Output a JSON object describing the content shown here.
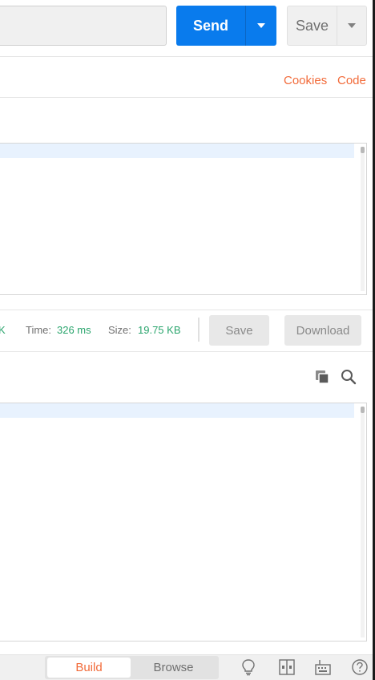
{
  "request": {
    "send_label": "Send",
    "save_label": "Save"
  },
  "links": {
    "cookies": "Cookies",
    "code": "Code"
  },
  "response": {
    "status_fragment": "K",
    "time_label": "Time:",
    "time_value": "326 ms",
    "size_label": "Size:",
    "size_value": "19.75 KB",
    "save_label": "Save",
    "download_label": "Download"
  },
  "footer": {
    "build_label": "Build",
    "browse_label": "Browse",
    "icons": [
      "bulb-icon",
      "two-pane-icon",
      "keyboard-icon",
      "help-icon"
    ]
  },
  "colors": {
    "accent_blue": "#097bed",
    "accent_orange": "#f26b3a",
    "status_green": "#2aa56d"
  }
}
